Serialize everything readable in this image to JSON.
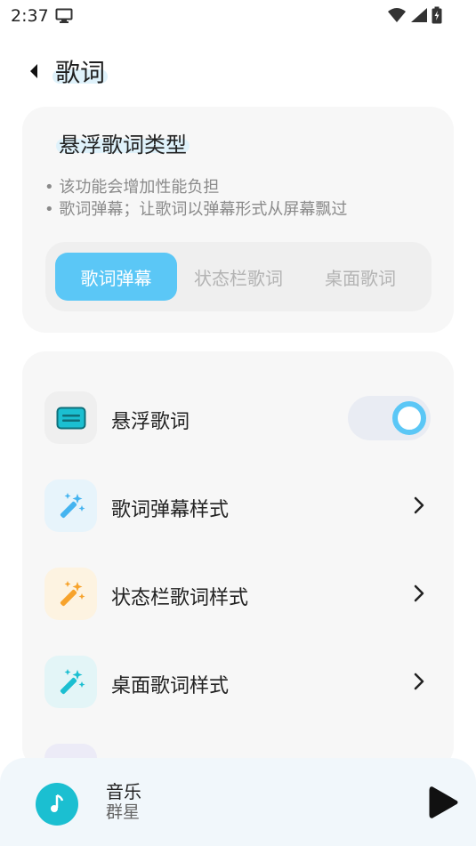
{
  "status_bar": {
    "time": "2:37",
    "icons": [
      "monitor-icon",
      "wifi-icon",
      "signal-icon",
      "battery-charging-icon"
    ]
  },
  "header": {
    "back_icon": "back-arrow-icon",
    "title": "歌词"
  },
  "type_card": {
    "title": "悬浮歌词类型",
    "desc_lines": [
      "• 该功能会增加性能负担",
      "• 歌词弹幕；让歌词以弹幕形式从屏幕飘过"
    ],
    "options": [
      {
        "label": "歌词弹幕",
        "selected": true
      },
      {
        "label": "状态栏歌词",
        "selected": false
      },
      {
        "label": "桌面歌词",
        "selected": false
      }
    ]
  },
  "settings": {
    "items": [
      {
        "label": "悬浮歌词",
        "icon": "subtitles-icon",
        "control": "toggle",
        "toggle_on": true
      },
      {
        "label": "歌词弹幕样式",
        "icon": "magic-wand-icon",
        "control": "chevron"
      },
      {
        "label": "状态栏歌词样式",
        "icon": "magic-wand-icon",
        "control": "chevron"
      },
      {
        "label": "桌面歌词样式",
        "icon": "magic-wand-icon",
        "control": "chevron"
      }
    ]
  },
  "player": {
    "song": "音乐",
    "artist": "群星",
    "play_icon": "play-icon"
  },
  "colors": {
    "accent": "#5bc7f6",
    "card_bg": "#f7f7f7",
    "icon_teal": "#1bbfd1",
    "icon_orange": "#f7a32c",
    "icon_blue": "#45b4f0"
  }
}
